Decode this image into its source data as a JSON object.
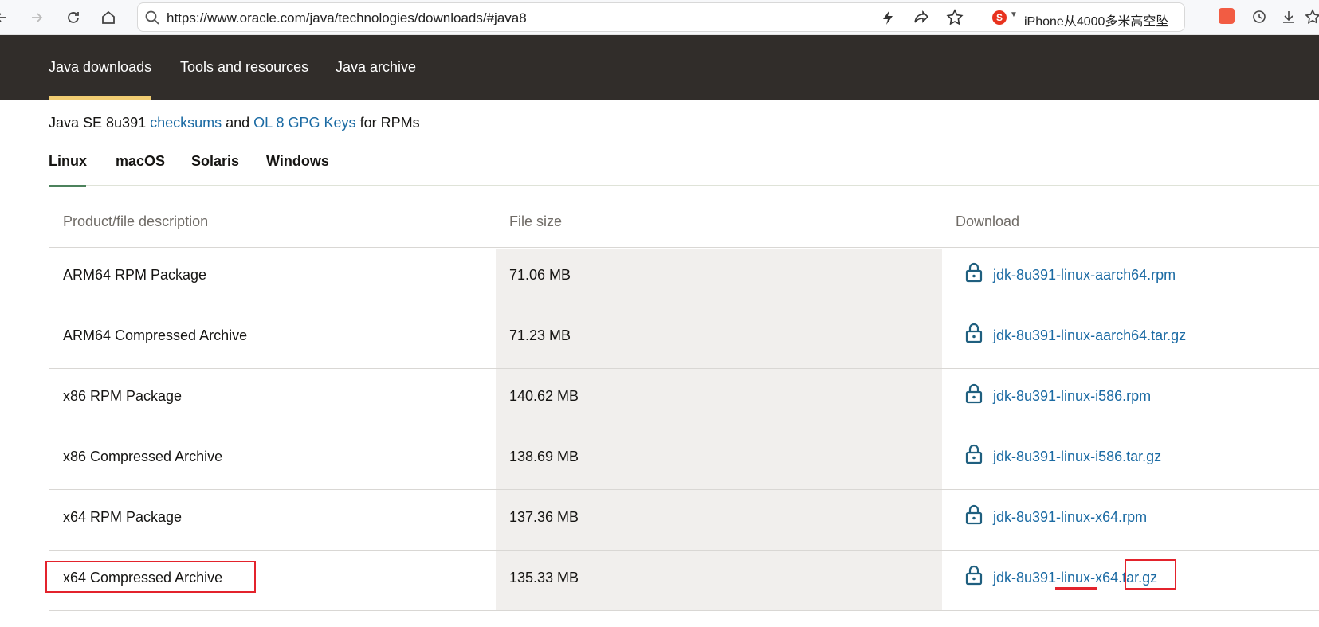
{
  "browser": {
    "url": "https://www.oracle.com/java/technologies/downloads/#java8",
    "hot_news": "iPhone从4000多米高空坠"
  },
  "site_nav": {
    "tabs": [
      "Java downloads",
      "Tools and resources",
      "Java archive"
    ]
  },
  "checksum": {
    "prefix": "Java SE 8u391 ",
    "checksums_link": "checksums",
    "and": " and ",
    "gpg_link": "OL 8 GPG Keys",
    "suffix": " for RPMs"
  },
  "os_tabs": [
    "Linux",
    "macOS",
    "Solaris",
    "Windows"
  ],
  "table": {
    "headers": [
      "Product/file description",
      "File size",
      "Download"
    ],
    "rows": [
      {
        "description": "ARM64 RPM Package",
        "size": "71.06 MB",
        "file": "jdk-8u391-linux-aarch64.rpm"
      },
      {
        "description": "ARM64 Compressed Archive",
        "size": "71.23 MB",
        "file": "jdk-8u391-linux-aarch64.tar.gz"
      },
      {
        "description": "x86 RPM Package",
        "size": "140.62 MB",
        "file": "jdk-8u391-linux-i586.rpm"
      },
      {
        "description": "x86 Compressed Archive",
        "size": "138.69 MB",
        "file": "jdk-8u391-linux-i586.tar.gz"
      },
      {
        "description": "x64 RPM Package",
        "size": "137.36 MB",
        "file": "jdk-8u391-linux-x64.rpm"
      },
      {
        "description": "x64 Compressed Archive",
        "size": "135.33 MB",
        "file": "jdk-8u391-linux-x64.tar.gz"
      }
    ]
  },
  "colors": {
    "nav_bg": "#312d2a",
    "link": "#1a6aa3",
    "annotation": "#e3232c"
  }
}
